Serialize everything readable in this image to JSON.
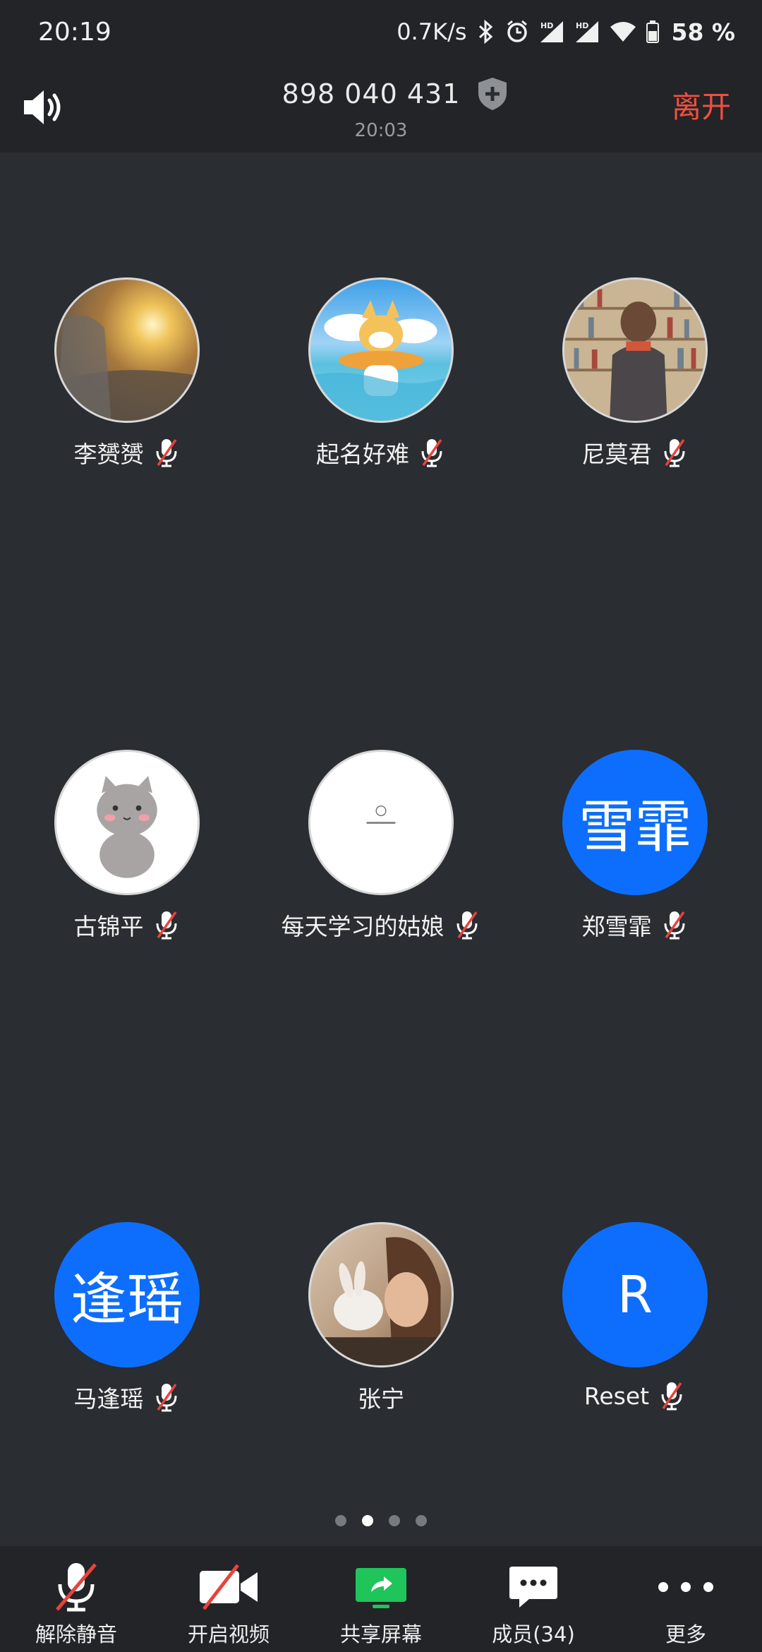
{
  "status_bar": {
    "time": "20:19",
    "net_speed": "0.7K/s",
    "battery": "58 %"
  },
  "header": {
    "meeting_id": "898 040 431",
    "duration": "20:03",
    "leave_label": "离开"
  },
  "participants": [
    {
      "name": "李赟赟",
      "avatar_text": "",
      "muted": true
    },
    {
      "name": "起名好难",
      "avatar_text": "",
      "muted": true
    },
    {
      "name": "尼莫君",
      "avatar_text": "",
      "muted": true
    },
    {
      "name": "古锦平",
      "avatar_text": "",
      "muted": true
    },
    {
      "name": "每天学习的姑娘",
      "avatar_text": "",
      "muted": true
    },
    {
      "name": "郑雪霏",
      "avatar_text": "雪霏",
      "muted": true
    },
    {
      "name": "马逢瑶",
      "avatar_text": "逢瑶",
      "muted": true
    },
    {
      "name": "张宁",
      "avatar_text": "",
      "muted": false
    },
    {
      "name": "Reset",
      "avatar_text": "R",
      "muted": true
    }
  ],
  "pagination": {
    "pages": 4,
    "current": 2
  },
  "toolbar": {
    "unmute_label": "解除静音",
    "video_label": "开启视频",
    "share_label": "共享屏幕",
    "members_label": "成员(34)",
    "more_label": "更多"
  },
  "colors": {
    "background": "#2a2d31",
    "bar": "#232427",
    "accent_blue": "#0d6efd",
    "leave_red": "#f0503f",
    "share_green": "#1fc45a",
    "mute_slash": "#e8433a"
  }
}
